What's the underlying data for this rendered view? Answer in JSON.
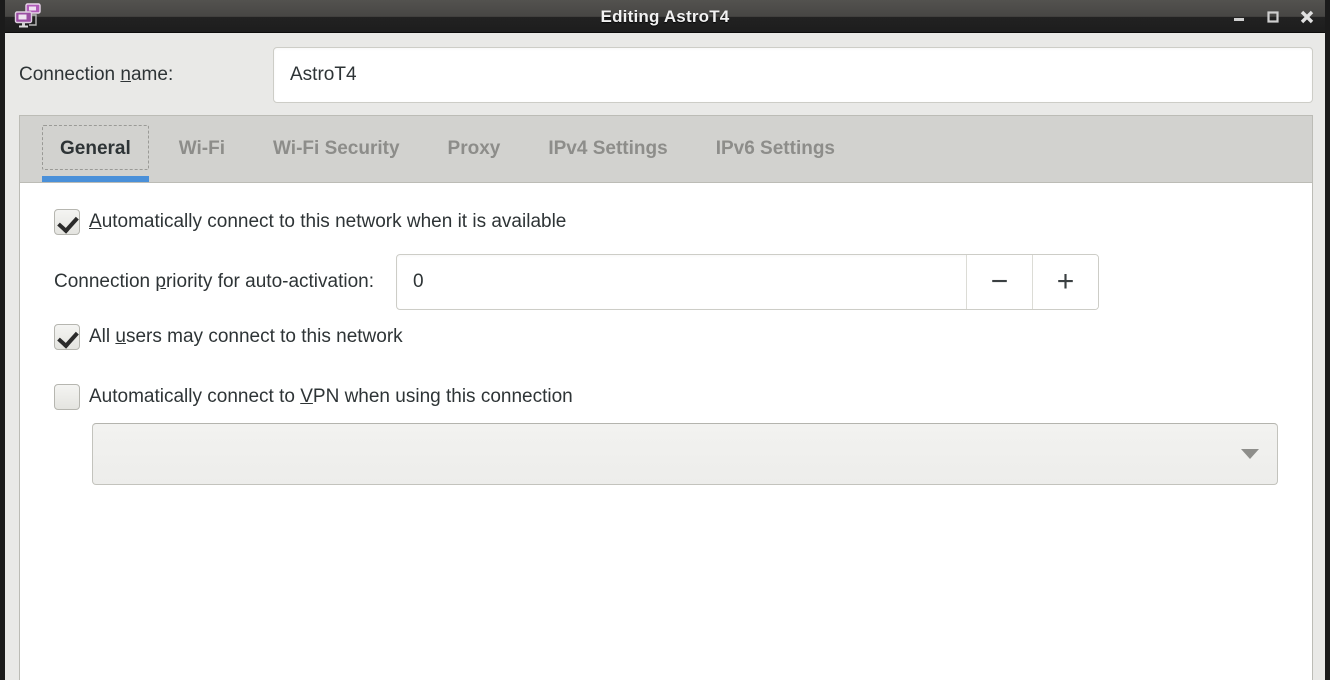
{
  "window": {
    "title": "Editing AstroT4",
    "icon": "network-connection-icon",
    "controls": {
      "minimize": "minimize-icon",
      "maximize": "maximize-icon",
      "close": "close-icon"
    }
  },
  "name_row": {
    "label_pre": "Connection ",
    "label_mnemonic": "n",
    "label_post": "ame:",
    "value": "AstroT4",
    "placeholder": ""
  },
  "tabs": [
    {
      "label": "General",
      "active": true
    },
    {
      "label": "Wi-Fi",
      "active": false
    },
    {
      "label": "Wi-Fi Security",
      "active": false
    },
    {
      "label": "Proxy",
      "active": false
    },
    {
      "label": "IPv4 Settings",
      "active": false
    },
    {
      "label": "IPv6 Settings",
      "active": false
    }
  ],
  "general": {
    "autoconnect": {
      "pre": "",
      "mnemonic": "A",
      "post": "utomatically connect to this network when it is available",
      "checked": true
    },
    "priority": {
      "label_pre": "Connection ",
      "label_mnemonic": "p",
      "label_post": "riority for auto-activation:",
      "value": "0",
      "decrement_label": "−",
      "increment_label": "+"
    },
    "all_users": {
      "pre": "All ",
      "mnemonic": "u",
      "post": "sers may connect to this network",
      "checked": true
    },
    "vpn": {
      "pre": "Automatically connect to ",
      "mnemonic": "V",
      "post": "PN when using this connection",
      "checked": false
    },
    "vpn_combo": {
      "value": "",
      "arrow": "chevron-down-icon"
    }
  },
  "colors": {
    "accent": "#4a90d9",
    "titlebar_top": "#53524f",
    "titlebar_bottom": "#1d1d1d",
    "tabbar_bg": "#d2d2cf",
    "window_bg": "#e9e9e7",
    "text": "#2e3436",
    "inactive_tab_text": "#8d8d8a"
  }
}
